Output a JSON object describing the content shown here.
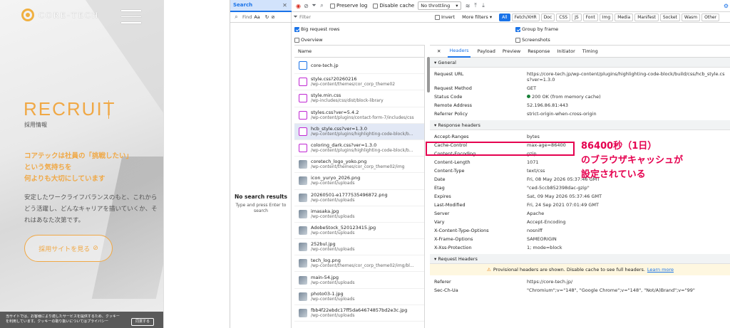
{
  "site": {
    "logo": "CORE-TECH",
    "heading": "RECRUIT",
    "subheading": "採用情報",
    "catch": [
      "コアテックは社員の「挑戦したい」",
      "という気持ちを",
      "何よりも大切にしています"
    ],
    "desc": "安定したワークライフバランスのもと、これからどう活躍し、どんなキャリアを描いていくか、それはあなた次第です。",
    "button": "採用サイトを見る",
    "cookie": "当サイトでは、お客様により適したサービスを提供するため、クッキーを利用しています。クッキーの取り扱いについてはプライバシー",
    "cookie_btn": "同意する"
  },
  "devtools": {
    "search_tab": "Search",
    "preserve_log": "Preserve log",
    "disable_cache": "Disable cache",
    "throttling": "No throttling",
    "search_placeholder": "Find",
    "filter_placeholder": "Filter",
    "invert": "Invert",
    "more_filters": "More filters",
    "chips": [
      "All",
      "Fetch/XHR",
      "Doc",
      "CSS",
      "JS",
      "Font",
      "Img",
      "Media",
      "Manifest",
      "Socket",
      "Wasm",
      "Other"
    ],
    "no_results": "No search results",
    "no_results_hint": "Type and press Enter to search",
    "options": {
      "big_rows": "Big request rows",
      "overview": "Overview",
      "group": "Group by frame",
      "screenshots": "Screenshots"
    },
    "name_col": "Name",
    "requests": [
      {
        "name": "core-tech.jp",
        "path": "",
        "type": "doc"
      },
      {
        "name": "style.css?20260216",
        "path": "/wp-content/themes/cor_corp_theme02",
        "type": "css"
      },
      {
        "name": "style.min.css",
        "path": "/wp-includes/css/dist/block-library",
        "type": "css"
      },
      {
        "name": "styles.css?ver=5.4.2",
        "path": "/wp-content/plugins/contact-form-7/includes/css",
        "type": "css"
      },
      {
        "name": "hcb_style.css?ver=1.3.0",
        "path": "/wp-content/plugins/highlighting-code-block/b...",
        "type": "css"
      },
      {
        "name": "coloring_dark.css?ver=1.3.0",
        "path": "/wp-content/plugins/highlighting-code-block/b...",
        "type": "css"
      },
      {
        "name": "coretech_logo_yoko.png",
        "path": "/wp-content/themes/cor_corp_theme02/img",
        "type": "img"
      },
      {
        "name": "icon_yuryo_2026.png",
        "path": "/wp-content/uploads",
        "type": "img"
      },
      {
        "name": "20260501-e1777535496872.png",
        "path": "/wp-content/uploads",
        "type": "img"
      },
      {
        "name": "imasaka.jpg",
        "path": "/wp-content/uploads",
        "type": "img"
      },
      {
        "name": "AdobeStock_520123415.jpg",
        "path": "/wp-content/uploads",
        "type": "img"
      },
      {
        "name": "252bul.jpg",
        "path": "/wp-content/uploads",
        "type": "img"
      },
      {
        "name": "tech_log.png",
        "path": "/wp-content/themes/cor_corp_theme02/img/bl...",
        "type": "img"
      },
      {
        "name": "main-54.jpg",
        "path": "/wp-content/uploads",
        "type": "img"
      },
      {
        "name": "photo03-1.jpg",
        "path": "/wp-content/uploads",
        "type": "img"
      },
      {
        "name": "fbb4f22ebdc17ff5da64674857bd2e3c.jpg",
        "path": "/wp-content/uploads",
        "type": "img"
      }
    ],
    "tabs": [
      "Headers",
      "Payload",
      "Preview",
      "Response",
      "Initiator",
      "Timing"
    ],
    "general_title": "General",
    "general": [
      {
        "k": "Request URL",
        "v": "https://core-tech.jp/wp-content/plugins/highlighting-code-block/build/css/hcb_style.css?ver=1.3.0"
      },
      {
        "k": "Request Method",
        "v": "GET"
      },
      {
        "k": "Status Code",
        "v": "200 OK (from memory cache)"
      },
      {
        "k": "Remote Address",
        "v": "52.196.86.81:443"
      },
      {
        "k": "Referrer Policy",
        "v": "strict-origin-when-cross-origin"
      }
    ],
    "response_title": "Response headers",
    "response": [
      {
        "k": "Accept-Ranges",
        "v": "bytes"
      },
      {
        "k": "Cache-Control",
        "v": "max-age=86400"
      },
      {
        "k": "Content-Encoding",
        "v": "gzip"
      },
      {
        "k": "Content-Length",
        "v": "1071"
      },
      {
        "k": "Content-Type",
        "v": "text/css"
      },
      {
        "k": "Date",
        "v": "Fri, 08 May 2026 05:37:46 GMT"
      },
      {
        "k": "Etag",
        "v": "\"ced-5ccb852398dac-gzip\""
      },
      {
        "k": "Expires",
        "v": "Sat, 09 May 2026 05:37:46 GMT"
      },
      {
        "k": "Last-Modified",
        "v": "Fri, 24 Sep 2021 07:01:49 GMT"
      },
      {
        "k": "Server",
        "v": "Apache"
      },
      {
        "k": "Vary",
        "v": "Accept-Encoding"
      },
      {
        "k": "X-Content-Type-Options",
        "v": "nosniff"
      },
      {
        "k": "X-Frame-Options",
        "v": "SAMEORIGIN"
      },
      {
        "k": "X-Xss-Protection",
        "v": "1; mode=block"
      }
    ],
    "request_title": "Request Headers",
    "warning": "Provisional headers are shown. Disable cache to see full headers.",
    "learn_more": "Learn more",
    "request": [
      {
        "k": "Referer",
        "v": "https://core-tech.jp/"
      },
      {
        "k": "Sec-Ch-Ua",
        "v": "\"Chromium\";v=\"148\", \"Google Chrome\";v=\"148\", \"Not/A)Brand\";v=\"99\""
      }
    ]
  },
  "annotation": [
    "86400秒（1日）",
    "のブラウザキャッシュが",
    "設定されている"
  ]
}
